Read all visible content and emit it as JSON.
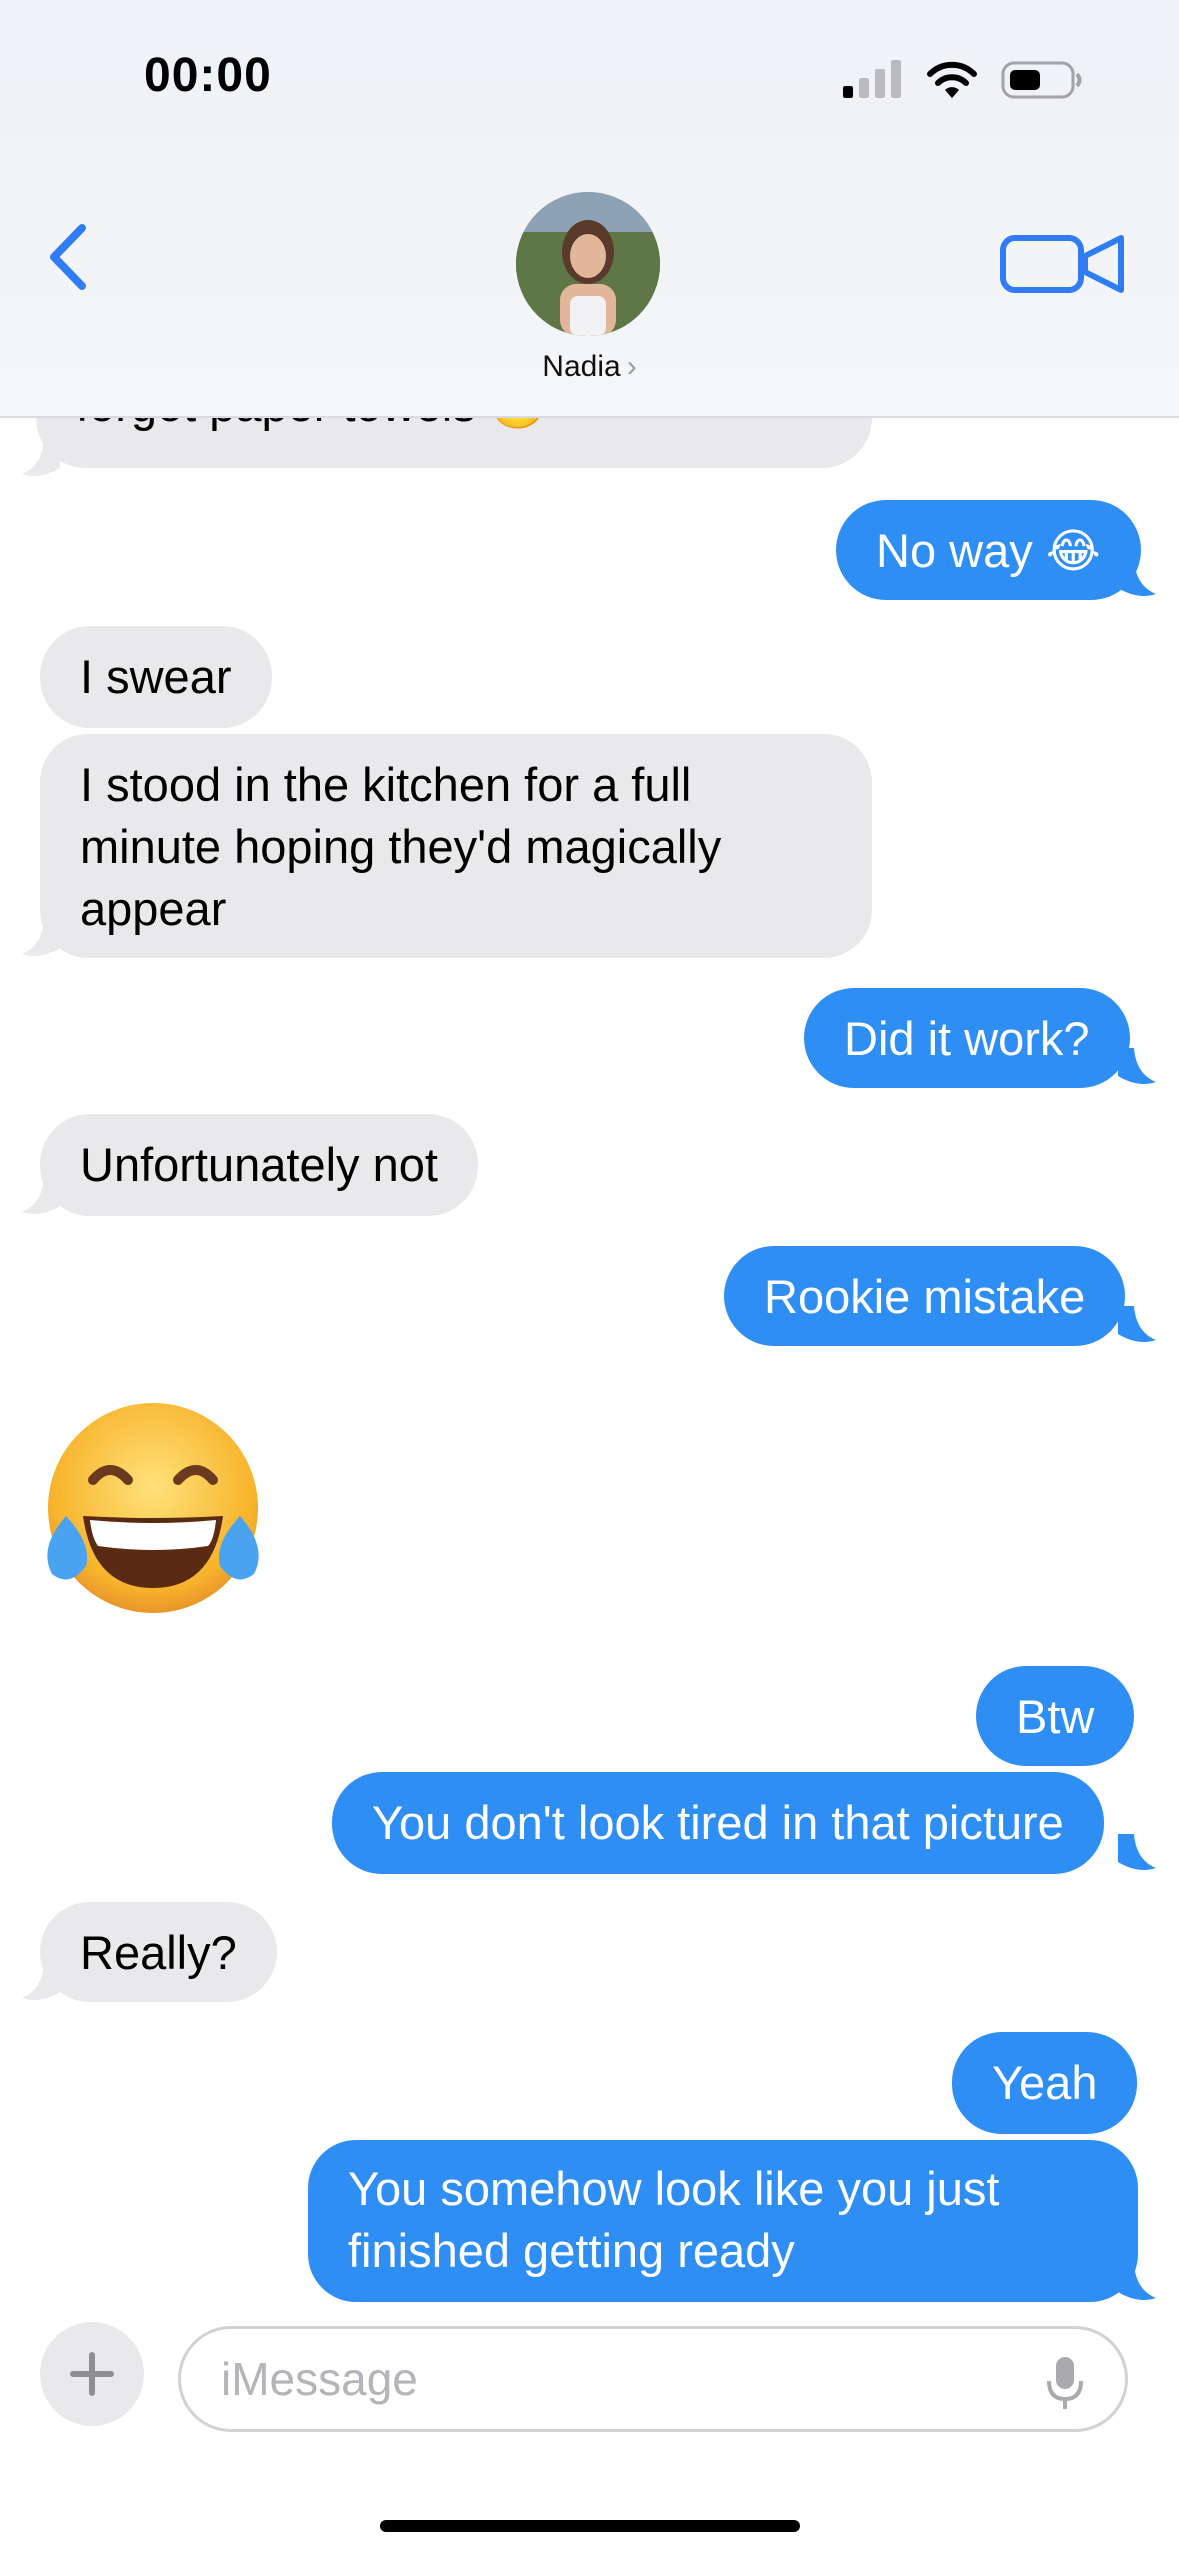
{
  "status_bar": {
    "time": "00:00"
  },
  "header": {
    "contact_name": "Nadia",
    "chevron": "›"
  },
  "messages": [
    {
      "side": "in",
      "text": "forgot paper towels 😬"
    },
    {
      "side": "out",
      "text": "No way 😂"
    },
    {
      "side": "in",
      "text": "I swear"
    },
    {
      "side": "in",
      "text": "I stood in the kitchen for a full minute hoping they'd magically appear"
    },
    {
      "side": "out",
      "text": "Did it work?"
    },
    {
      "side": "in",
      "text": "Unfortunately not"
    },
    {
      "side": "out",
      "text": "Rookie mistake"
    },
    {
      "side": "in",
      "text": "😂"
    },
    {
      "side": "out",
      "text": "Btw"
    },
    {
      "side": "out",
      "text": "You don't look tired in that picture"
    },
    {
      "side": "in",
      "text": "Really?"
    },
    {
      "side": "out",
      "text": "Yeah"
    },
    {
      "side": "out",
      "text": "You somehow look like you just finished getting ready"
    }
  ],
  "composer": {
    "placeholder": "iMessage"
  },
  "icons": {
    "back": "chevron-left-icon",
    "video": "video-camera-icon",
    "plus": "plus-icon",
    "mic": "microphone-icon",
    "signal": "cellular-signal-icon",
    "wifi": "wifi-icon",
    "battery": "battery-icon"
  },
  "colors": {
    "outgoing": "#2f8ef4",
    "incoming": "#e9e9eb",
    "accent": "#2f7cf6"
  }
}
